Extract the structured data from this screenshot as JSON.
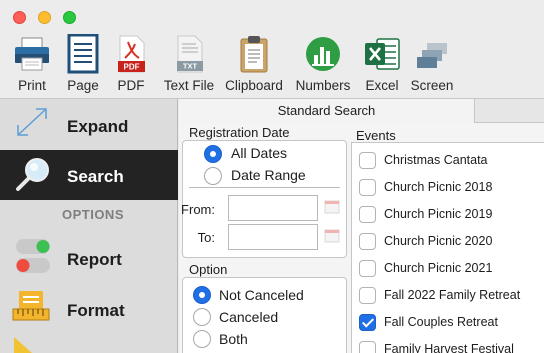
{
  "toolbar": {
    "items": [
      {
        "label": "Print",
        "icon": "printer-icon"
      },
      {
        "label": "Page",
        "icon": "page-icon"
      },
      {
        "label": "PDF",
        "icon": "pdf-icon"
      },
      {
        "label": "Text File",
        "icon": "text-file-icon"
      },
      {
        "label": "Clipboard",
        "icon": "clipboard-icon"
      },
      {
        "label": "Numbers",
        "icon": "numbers-icon"
      },
      {
        "label": "Excel",
        "icon": "excel-icon"
      },
      {
        "label": "Screen",
        "icon": "screen-icon"
      }
    ],
    "pdf_badge": "PDF",
    "txt_badge": "TXT"
  },
  "sidebar": {
    "expand": "Expand",
    "search": "Search",
    "options_header": "OPTIONS",
    "report": "Report",
    "format": "Format"
  },
  "tabs": {
    "active": "Standard Search"
  },
  "registration": {
    "label": "Registration Date",
    "all_dates": "All Dates",
    "date_range": "Date Range",
    "from_label": "From:",
    "to_label": "To:",
    "from_value": "",
    "to_value": ""
  },
  "option": {
    "label": "Option",
    "not_canceled": "Not Canceled",
    "canceled": "Canceled",
    "both": "Both"
  },
  "events": {
    "label": "Events",
    "items": [
      {
        "label": "Christmas Cantata",
        "checked": false
      },
      {
        "label": "Church Picnic 2018",
        "checked": false
      },
      {
        "label": "Church Picnic 2019",
        "checked": false
      },
      {
        "label": "Church Picnic 2020",
        "checked": false
      },
      {
        "label": "Church Picnic 2021",
        "checked": false
      },
      {
        "label": "Fall 2022 Family Retreat",
        "checked": false
      },
      {
        "label": "Fall Couples Retreat",
        "checked": true
      },
      {
        "label": "Family Harvest Festival",
        "checked": false
      }
    ]
  },
  "colors": {
    "accent": "#1f6fe5",
    "sidebar_selected": "#232323"
  }
}
